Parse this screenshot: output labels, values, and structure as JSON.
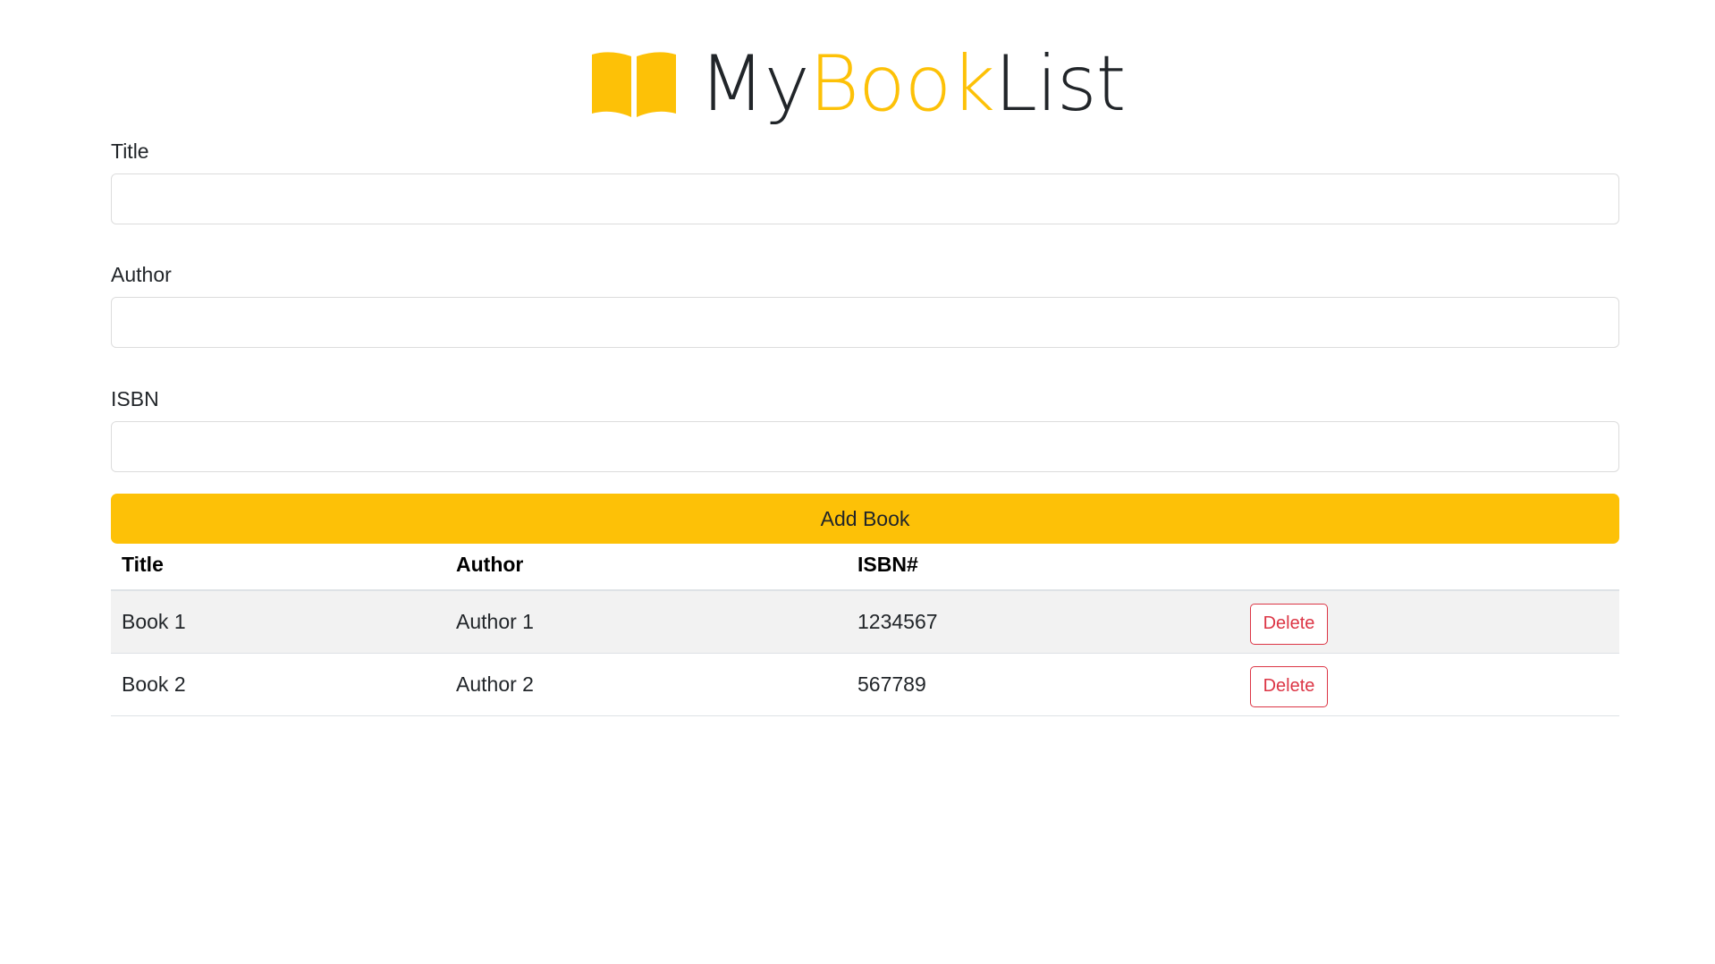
{
  "app": {
    "logo": {
      "icon": "open-book-icon",
      "part1": "My",
      "part2": "Book",
      "part3": "List",
      "accent_color": "#fdc107",
      "text_color": "#212529"
    }
  },
  "form": {
    "title_label": "Title",
    "title_value": "",
    "author_label": "Author",
    "author_value": "",
    "isbn_label": "ISBN",
    "isbn_value": "",
    "submit_label": "Add Book",
    "submit_color": "#fdc107"
  },
  "table": {
    "headers": [
      "Title",
      "Author",
      "ISBN#",
      ""
    ],
    "rows": [
      {
        "title": "Book 1",
        "author": "Author 1",
        "isbn": "1234567",
        "action": "Delete"
      },
      {
        "title": "Book 2",
        "author": "Author 2",
        "isbn": "567789",
        "action": "Delete"
      }
    ],
    "delete_color": "#dc3545"
  }
}
